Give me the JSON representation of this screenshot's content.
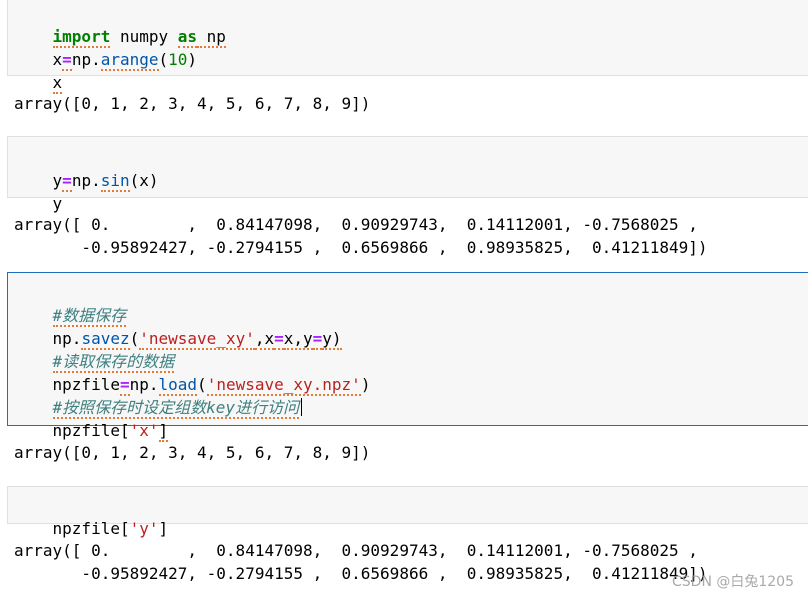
{
  "cells": [
    {
      "lines": [
        [
          "import",
          " numpy ",
          "as",
          " np"
        ],
        [
          "x",
          "=",
          "np.",
          "arange",
          "(",
          "10",
          ")"
        ],
        [
          "x"
        ]
      ],
      "output": [
        "array([0, 1, 2, 3, 4, 5, 6, 7, 8, 9])"
      ]
    },
    {
      "lines": [
        [
          "y",
          "=",
          "np.",
          "sin",
          "(x)"
        ],
        [
          "y"
        ]
      ],
      "output": [
        "array([ 0.        ,  0.84147098,  0.90929743,  0.14112001, -0.7568025 ,",
        "       -0.95892427, -0.2794155 ,  0.6569866 ,  0.98935825,  0.41211849])"
      ]
    },
    {
      "lines": [
        [
          "#数据保存"
        ],
        [
          "np.",
          "savez",
          "(",
          "'newsave_xy'",
          ",x",
          "=",
          "x,y",
          "=",
          "y)"
        ],
        [
          "#读取保存的数据"
        ],
        [
          "npzfile",
          "=",
          "np.",
          "load",
          "(",
          "'newsave_xy.npz'",
          ")"
        ],
        [
          "#按照保存时设定组数key进行访问"
        ],
        [
          "npzfile[",
          "'x'",
          "]"
        ]
      ],
      "output": [
        "array([0, 1, 2, 3, 4, 5, 6, 7, 8, 9])"
      ]
    },
    {
      "lines": [
        [
          "npzfile[",
          "'y'",
          "]"
        ]
      ],
      "output": [
        "array([ 0.        ,  0.84147098,  0.90929743,  0.14112001, -0.7568025 ,",
        "       -0.95892427, -0.2794155 ,  0.6569866 ,  0.98935825,  0.41211849])"
      ]
    }
  ],
  "watermark": "CSDN @白兔1205",
  "colors": {
    "keyword": "#008000",
    "function": "#0055aa",
    "string": "#ba2121",
    "operator": "#aa22ff",
    "comment": "#408080",
    "selected_border": "#1f6fc0"
  }
}
